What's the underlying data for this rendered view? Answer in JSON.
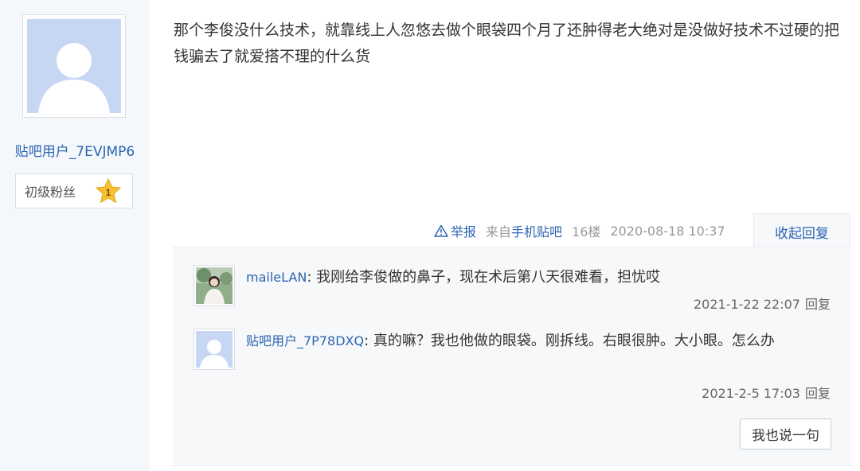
{
  "author": {
    "name": "贴吧用户_7EVJMP6",
    "fan_level_label": "初级粉丝",
    "fan_level_number": "1"
  },
  "post": {
    "content": "那个李俊没什么技术，就靠线上人忽悠去做个眼袋四个月了还肿得老大绝对是没做好技术不过硬的把钱骗去了就爱搭不理的什么货",
    "report_label": "举报",
    "from_label": "来自",
    "client_label": "手机贴吧",
    "floor": "16楼",
    "time": "2020-08-18 10:37",
    "collapse_label": "收起回复"
  },
  "replies": [
    {
      "user": "maileLAN",
      "text": ": 我刚给李俊做的鼻子，现在术后第八天很难看，担忧哎",
      "time": "2021-1-22 22:07",
      "reply_label": "回复"
    },
    {
      "user": "贴吧用户_7P78DXQ",
      "text": ": 真的嘛？我也他做的眼袋。刚拆线。右眼很肿。大小眼。怎么办",
      "time": "2021-2-5 17:03",
      "reply_label": "回复"
    }
  ],
  "say_button_label": "我也说一句",
  "colors": {
    "link": "#2d64b3",
    "sidebar_bg": "#f5f8fb",
    "reply_bg": "#f7f8fa",
    "avatar_placeholder": "#c6d6f3",
    "star": "#f5c132"
  }
}
